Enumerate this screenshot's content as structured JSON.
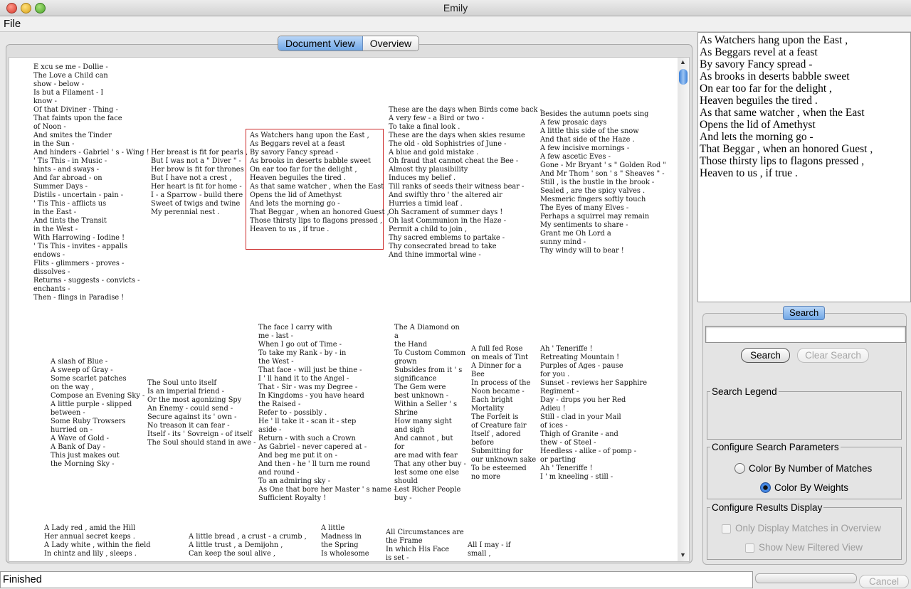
{
  "window": {
    "title": "Emily"
  },
  "menu": {
    "file": "File"
  },
  "view_tabs": {
    "document_view": "Document View",
    "overview": "Overview"
  },
  "poems": [
    "E xcu se me - Dollie -\nThe Love a Child can\nshow - below -\nIs but a Filament - I\nknow -\nOf that Diviner - Thing -\nThat faints upon the face\nof Noon -\nAnd smites the Tinder\nin the Sun -\nAnd hinders - Gabriel ' s - Wing !\n' Tis This - in Music -\nhints - and sways -\nAnd far abroad - on\nSummer Days -\nDistils - uncertain - pain -\n' Tis This - afflicts us\nin the East -\nAnd tints the Transit\nin the West -\nWith Harrowing - Iodine !\n' Tis This - invites - appalls\nendows -\nFlits - glimmers - proves -\ndissolves -\nReturns - suggests - convicts -\nenchants -\nThen - flings in Paradise !",
    "Her breast is fit for pearls ,\nBut I was not a \" Diver \" -\nHer brow is fit for thrones\nBut I have not a crest ,\nHer heart is fit for home -\nI - a Sparrow - build there\nSweet of twigs and twine\nMy perennial nest .",
    "As Watchers hang upon the East ,\nAs Beggars revel at a feast\nBy savory Fancy spread -\nAs brooks in deserts babble sweet\nOn ear too far for the delight ,\nHeaven beguiles the tired .\nAs that same watcher , when the East\nOpens the lid of Amethyst\nAnd lets the morning go -\nThat Beggar , when an honored Guest ,\nThose thirsty lips to flagons pressed ,\nHeaven to us , if true .",
    "These are the days when Birds come back -\nA very few - a Bird or two -\nTo take a final look .\nThese are the days when skies resume\nThe old - old Sophistries of June -\nA blue and gold mistake .\nOh fraud that cannot cheat the Bee -\nAlmost thy plausibility\nInduces my belief .\nTill ranks of seeds their witness bear -\nAnd swiftly thro ' the altered air\nHurries a timid leaf .\nOh Sacrament of summer days !\nOh last Communion in the Haze -\nPermit a child to join ,\nThy sacred emblems to partake -\nThy consecrated bread to take\nAnd thine immortal wine -",
    "Besides the autumn poets sing\nA few prosaic days\nA little this side of the snow\nAnd that side of the Haze .\nA few incisive mornings -\nA few ascetic Eves -\nGone - Mr Bryant ' s \" Golden Rod \"\nAnd Mr Thom ' son ' s \" Sheaves \" -\nStill , is the bustle in the brook -\nSealed , are the spicy valves .\nMesmeric fingers softly touch\nThe Eyes of many Elves -\nPerhaps a squirrel may remain\nMy sentiments to share -\nGrant me Oh Lord a\nsunny mind -\nThy windy will to bear !",
    "A slash of Blue -\nA sweep of Gray -\nSome scarlet patches\non the way ,\nCompose an Evening Sky -\nA little purple - slipped\nbetween -\nSome Ruby Trowsers\nhurried on -\nA Wave of Gold -\nA Bank of Day -\nThis just makes out\nthe Morning Sky -",
    "The Soul unto itself\nIs an imperial friend -\nOr the most agonizing Spy\nAn Enemy - could send -\nSecure against its ' own -\nNo treason it can fear -\nItself - its ' Sovreign - of itself\nThe Soul should stand in awe -",
    "The face I carry with\nme - last -\nWhen I go out of Time -\nTo take my Rank - by - in\nthe West -\nThat face - will just be thine -\nI ' ll hand it to the Angel -\nThat - Sir - was my Degree -\nIn Kingdoms - you have heard\nthe Raised -\nRefer to - possibly .\nHe ' ll take it - scan it - step\naside -\nReturn - with such a Crown\nAs Gabriel - never capered at -\nAnd beg me put it on -\nAnd then - he ' ll turn me round\nand round -\nTo an admiring sky -\nAs One that bore her Master ' s name -\nSufficient Royalty !",
    "The A Diamond on\na\nthe Hand\nTo Custom Common\ngrown\nSubsides from it ' s\nsignificance\nThe Gem were\nbest unknown -\nWithin a Seller ' s\nShrine\nHow many sight\nand sigh\nAnd cannot , but\nfor\nare mad with fear\nThat any other buy -\nlest some one else\nshould\nLest Richer People\nbuy -",
    "A full fed Rose\non meals of Tint\nA Dinner for a\nBee\nIn process of the\nNoon became -\nEach bright\nMortality\nThe Forfeit is\nof Creature fair\nItself , adored\nbefore\nSubmitting for\nour unknown sake\nTo be esteemed\nno more",
    "Ah ' Teneriffe !\nRetreating Mountain !\nPurples of Ages - pause\nfor you .\nSunset - reviews her Sapphire\nRegiment -\nDay - drops you her Red\nAdieu !\nStill - clad in your Mail\nof ices -\nThigh of Granite - and\nthew - of Steel -\nHeedless - alike - of pomp -\nor parting\nAh ' Teneriffe !\nI ' m kneeling - still -",
    "A Lady red , amid the Hill\nHer annual secret keeps .\nA Lady white , within the field\nIn chintz and lily , sleeps .",
    "A little bread , a crust - a crumb ,\nA little trust , a Demijohn ,\nCan keep the soul alive ,",
    "A little\nMadness in\nthe Spring\nIs wholesome",
    "All Circumstances are\nthe Frame\nIn which His Face\nis set -",
    "All I may - if\nsmall ,"
  ],
  "reader": {
    "text": "As Watchers hang upon the East ,\nAs Beggars revel at a feast\nBy savory Fancy spread -\nAs brooks in deserts babble sweet\nOn ear too far for the delight ,\nHeaven beguiles the tired .\nAs that same watcher , when the East\nOpens the lid of Amethyst\nAnd lets the morning go -\nThat Beggar , when an honored Guest ,\nThose thirsty lips to flagons pressed ,\nHeaven to us , if true ."
  },
  "search": {
    "tab_label": "Search",
    "query": "",
    "search_button": "Search",
    "clear_button": "Clear Search",
    "legend_title": "Search Legend",
    "params_title": "Configure Search Parameters",
    "option_matches": "Color By Number of Matches",
    "option_weights": "Color By Weights",
    "selected_option": "Color By Weights",
    "results_title": "Configure Results Display",
    "only_display": "Only Display Matches in Overview",
    "show_filtered": "Show New Filtered View"
  },
  "status": {
    "text": "Finished",
    "cancel_button": "Cancel"
  },
  "colors": {
    "highlight_border": "#cc2b2b",
    "accent": "#6fa6e6"
  }
}
